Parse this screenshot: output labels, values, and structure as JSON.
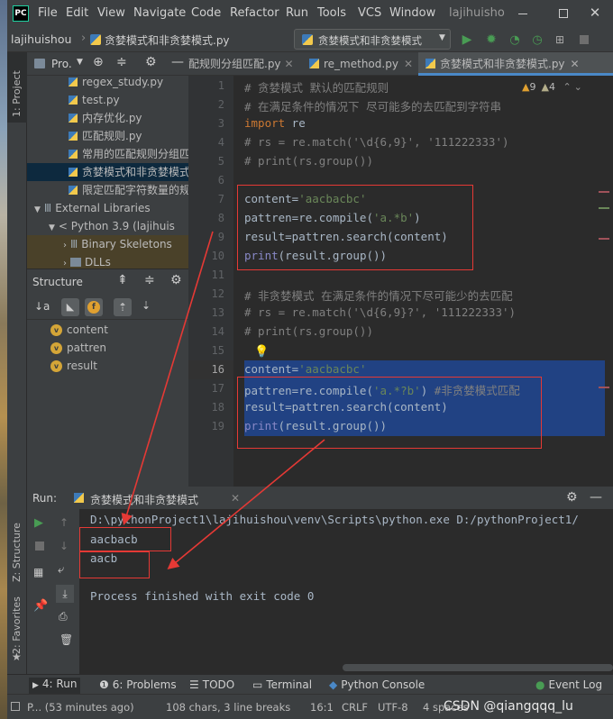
{
  "window": {
    "menu": [
      "File",
      "Edit",
      "View",
      "Navigate",
      "Code",
      "Refactor",
      "Run",
      "Tools",
      "VCS",
      "Window"
    ],
    "project_label": "lajihuisho"
  },
  "navbar": {
    "breadcrumb_project": "lajihuishou",
    "breadcrumb_file": "贪婪模式和非贪婪模式.py",
    "run_config": "贪婪模式和非贪婪模式"
  },
  "left_tool_labels": {
    "project": "1: Project",
    "structure": "Z: Structure",
    "favorites": "2: Favorites"
  },
  "project_panel": {
    "header": "Pro.",
    "items": [
      "regex_study.py",
      "test.py",
      "内存优化.py",
      "匹配规则.py",
      "常用的匹配规则分组匹",
      "贪婪模式和非贪婪模式",
      "限定匹配字符数量的规",
      "External Libraries",
      "< Python 3.9 (lajihuis",
      "Binary Skeletons",
      "DLLs"
    ]
  },
  "structure_panel": {
    "title": "Structure",
    "items": [
      "content",
      "pattren",
      "result"
    ]
  },
  "editor_tabs": [
    "配规则分组匹配.py",
    "re_method.py",
    "贪婪模式和非贪婪模式.py"
  ],
  "inspection": {
    "warnings": "9",
    "weak_warnings": "4"
  },
  "code_lines": [
    {
      "n": "1",
      "parts": [
        {
          "t": "# 贪婪模式 默认的匹配规则",
          "c": "cm"
        }
      ]
    },
    {
      "n": "2",
      "parts": [
        {
          "t": "# 在满足条件的情况下 尽可能多的去匹配到字符串",
          "c": "cm"
        }
      ]
    },
    {
      "n": "3",
      "parts": [
        {
          "t": "import",
          "c": "kw"
        },
        {
          "t": " re",
          "c": ""
        }
      ]
    },
    {
      "n": "4",
      "parts": [
        {
          "t": "# rs = re.match('\\d{6,9}', '111222333')",
          "c": "cm"
        }
      ]
    },
    {
      "n": "5",
      "parts": [
        {
          "t": "# print(rs.group())",
          "c": "cm"
        }
      ]
    },
    {
      "n": "6",
      "parts": []
    },
    {
      "n": "7",
      "parts": [
        {
          "t": "content=",
          "c": ""
        },
        {
          "t": "'aacbacbc'",
          "c": "st"
        }
      ]
    },
    {
      "n": "8",
      "parts": [
        {
          "t": "pattren=re.compile(",
          "c": ""
        },
        {
          "t": "'a.*b'",
          "c": "st"
        },
        {
          "t": ")",
          "c": ""
        }
      ]
    },
    {
      "n": "9",
      "parts": [
        {
          "t": "result=pattren.search(content)",
          "c": ""
        }
      ]
    },
    {
      "n": "10",
      "parts": [
        {
          "t": "print",
          "c": "fn"
        },
        {
          "t": "(result.group())",
          "c": ""
        }
      ]
    },
    {
      "n": "11",
      "parts": []
    },
    {
      "n": "12",
      "parts": [
        {
          "t": "# 非贪婪模式 在满足条件的情况下尽可能少的去匹配",
          "c": "cm"
        }
      ]
    },
    {
      "n": "13",
      "parts": [
        {
          "t": "# rs = re.match('\\d{6,9}?', '111222333')",
          "c": "cm"
        }
      ]
    },
    {
      "n": "14",
      "parts": [
        {
          "t": "# print(rs.group())",
          "c": "cm"
        }
      ]
    },
    {
      "n": "15",
      "parts": []
    },
    {
      "n": "16",
      "parts": [
        {
          "t": "content=",
          "c": ""
        },
        {
          "t": "'aacbacbc'",
          "c": "st"
        }
      ]
    },
    {
      "n": "17",
      "parts": [
        {
          "t": "pattren=re.compile(",
          "c": ""
        },
        {
          "t": "'a.*?b'",
          "c": "st"
        },
        {
          "t": ") ",
          "c": ""
        },
        {
          "t": "#非贪婪模式匹配",
          "c": "cm"
        }
      ]
    },
    {
      "n": "18",
      "parts": [
        {
          "t": "result=pattren.search(content)",
          "c": ""
        }
      ]
    },
    {
      "n": "19",
      "parts": [
        {
          "t": "print",
          "c": "fn"
        },
        {
          "t": "(result.group())",
          "c": ""
        }
      ]
    }
  ],
  "run_panel": {
    "label": "Run:",
    "config": "贪婪模式和非贪婪模式",
    "command": "D:\\pythonProject1\\lajihuishou\\venv\\Scripts\\python.exe D:/pythonProject1/",
    "output1": "aacbacb",
    "output2": "aacb",
    "exit": "Process finished with exit code 0"
  },
  "bottom_tabs": [
    "4: Run",
    "6: Problems",
    "TODO",
    "Terminal",
    "Python Console",
    "Event Log"
  ],
  "status": {
    "left": "P... (53 minutes ago)",
    "chars": "108 chars, 3 line breaks",
    "pos": "16:1",
    "eol": "CRLF",
    "enc": "UTF-8",
    "indent": "4 spaces",
    "watermark": "CSDN @qiangqqq_lu"
  },
  "colors": {
    "accent_selection": "#214283",
    "current_line": "#323232",
    "red_annotation": "#e53935",
    "run_green": "#499c54"
  }
}
